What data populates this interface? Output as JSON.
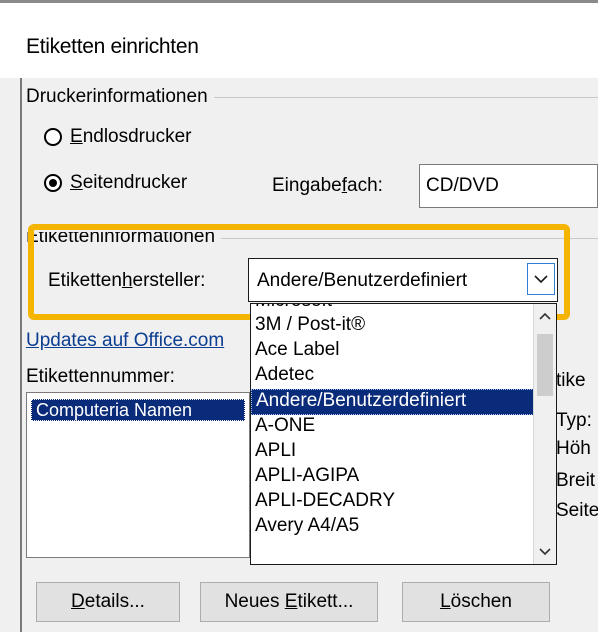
{
  "dialog": {
    "title": "Etiketten einrichten"
  },
  "printer_info": {
    "group_label": "Druckerinformationen",
    "continuous_label_pre": "",
    "continuous_label_ul": "E",
    "continuous_label_post": "ndlosdrucker",
    "page_label_pre": "",
    "page_label_ul": "S",
    "page_label_post": "eitendrucker",
    "selected": "page",
    "tray_label_pre": "Eingabe",
    "tray_label_ul": "f",
    "tray_label_post": "ach:",
    "tray_value": "CD/DVD"
  },
  "label_info": {
    "group_label": "Etiketteninformationen",
    "vendor_label_pre": "Etiketten",
    "vendor_label_ul": "h",
    "vendor_label_post": "ersteller:",
    "vendor_value": "Andere/Benutzerdefiniert",
    "updates_link": "Updates auf Office.com",
    "number_label": "Etikettennummer:",
    "number_selected": "Computeria Namen",
    "right_heading_fragment": "tike",
    "right_fragments": [
      "Typ:",
      "Höh",
      "Breit",
      "Seite"
    ]
  },
  "dropdown": {
    "items": [
      "Microsoft",
      "3M / Post-it®",
      "Ace Label",
      "Adetec",
      "Andere/Benutzerdefiniert",
      "A-ONE",
      "APLI",
      "APLI-AGIPA",
      "APLI-DECADRY",
      "Avery A4/A5"
    ],
    "selected_index": 4,
    "scroll_up_icon": "chevron-up-icon",
    "scroll_down_icon": "chevron-down-icon"
  },
  "buttons": {
    "details_pre": "",
    "details_ul": "D",
    "details_post": "etails...",
    "new_pre": "Neues ",
    "new_ul": "E",
    "new_post": "tikett...",
    "delete_pre": "",
    "delete_ul": "L",
    "delete_post": "öschen"
  },
  "colors": {
    "highlight": "#f5b400",
    "selection": "#0a2a7a",
    "link": "#0b3d91"
  }
}
